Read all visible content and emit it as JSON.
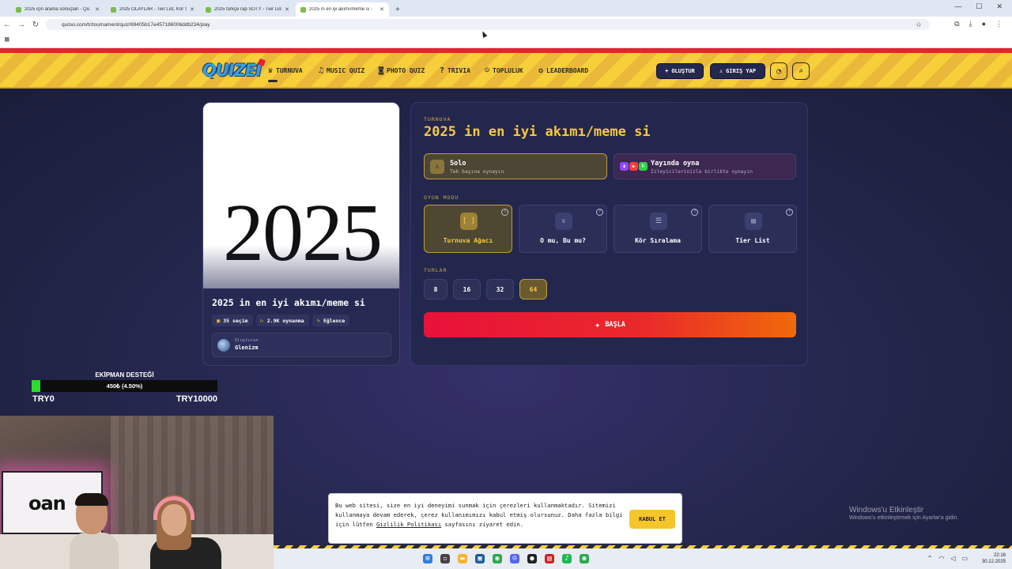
{
  "browser": {
    "tabs": [
      {
        "title": "2025 için arama sonuçları - Qu"
      },
      {
        "title": "2025 OLAYLAR - Tier List, Kör S"
      },
      {
        "title": "2025 türkçe rap SOTY - Tier List"
      },
      {
        "title": "2025 in en iyi akımı/meme si -"
      }
    ],
    "url": "quizei.com/tr/tournament/quiz/69405b17e457186006ddb234/play"
  },
  "site": {
    "logo": "QUIZEI",
    "nav": [
      {
        "label": "TURNUVA",
        "icon": "trophy-icon"
      },
      {
        "label": "MUSIC QUIZ",
        "icon": "music-icon"
      },
      {
        "label": "PHOTO QUIZ",
        "icon": "camera-icon"
      },
      {
        "label": "TRIVIA",
        "icon": "question-icon"
      },
      {
        "label": "TOPLULUK",
        "icon": "users-icon"
      },
      {
        "label": "LEADERBOARD",
        "icon": "medal-icon"
      }
    ],
    "create_label": "OLUŞTUR",
    "login_label": "GIRIŞ YAP"
  },
  "quiz": {
    "cover_text": "2025",
    "title": "2025 in en iyi akımı/meme si",
    "choices": "35 seçim",
    "plays": "2.9K oynanma",
    "category": "Eğlence",
    "creator_label": "Oluşturan",
    "creator_name": "Glenizm"
  },
  "setup": {
    "kicker": "TURNUVA",
    "title": "2025 in en iyi akımı/meme si",
    "modes": {
      "solo": {
        "name": "Solo",
        "sub": "Tek başına oynayın"
      },
      "live": {
        "name": "Yayında oyna",
        "sub": "İzleyicilerinizle birlikte oynayın"
      }
    },
    "game_mode_label": "OYUN MODU",
    "game_modes": [
      {
        "label": "Turnuva Ağacı",
        "icon": "bracket-icon",
        "selected": true
      },
      {
        "label": "O mu, Bu mu?",
        "icon": "crown-icon",
        "selected": false
      },
      {
        "label": "Kör Sıralama",
        "icon": "list-icon",
        "selected": false
      },
      {
        "label": "Tier List",
        "icon": "rows-icon",
        "selected": false
      }
    ],
    "rounds_label": "TURLAR",
    "rounds": [
      {
        "label": "8",
        "selected": false
      },
      {
        "label": "16",
        "selected": false
      },
      {
        "label": "32",
        "selected": false
      },
      {
        "label": "64",
        "selected": true
      }
    ],
    "start_label": "BAŞLA"
  },
  "overlay": {
    "donation_title": "EKİPMAN DESTEĞİ",
    "donation_progress_text": "450₺ (4.50%)",
    "donation_fraction": 0.045,
    "donation_min": "TRY0",
    "donation_max": "TRY10000",
    "tv_text": "oan"
  },
  "cookie": {
    "text_before": "Bu web sitesi, size en iyi deneyimi sunmak için çerezleri kullanmaktadır. Sitemizi kullanmaya devam ederek, çerez kullanımımızı kabul etmiş olursunuz. Daha fazla bilgi için lütfen ",
    "link": "Gizlilik Politikası",
    "text_after": " sayfasını ziyaret edin.",
    "accept_label": "KABUL ET"
  },
  "windows": {
    "activate_title": "Windows'u Etkinleştir",
    "activate_sub": "Windows'u etkinleştirmek için Ayarlar'a gidin.",
    "time": "22:16",
    "date": "30.12.2025"
  }
}
